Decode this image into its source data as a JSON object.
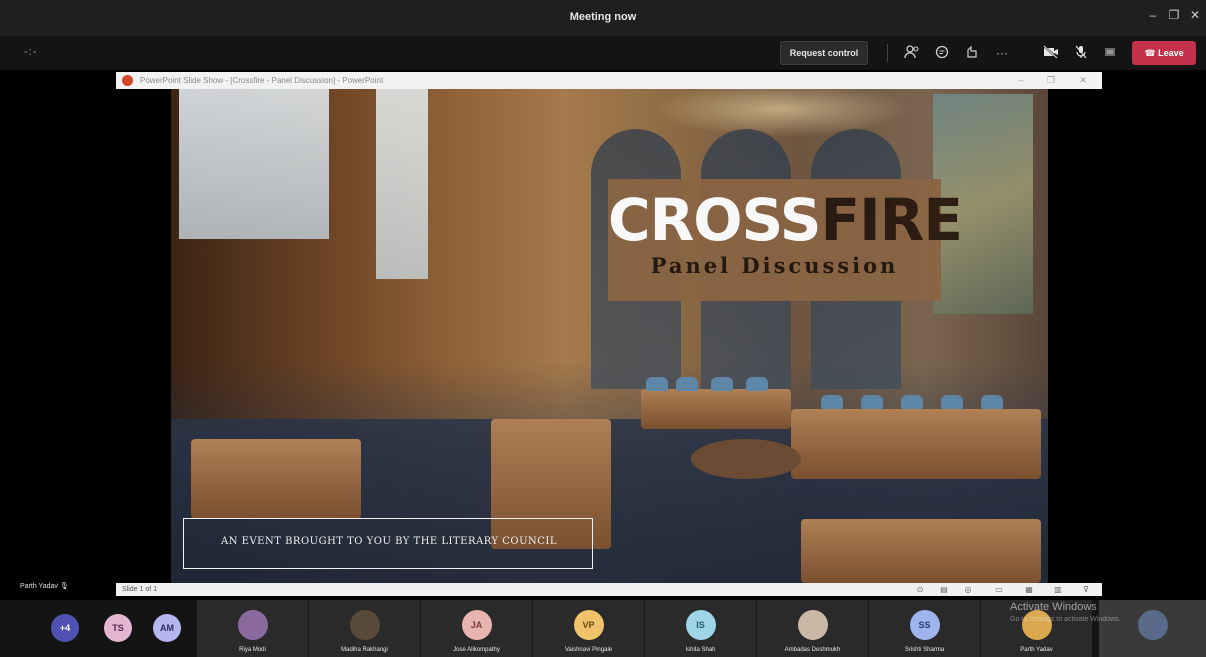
{
  "window": {
    "title": "Meeting now",
    "controls": {
      "minimize": "–",
      "restore": "❐",
      "close": "✕"
    }
  },
  "toolbar": {
    "timer": "-:-",
    "request_control": "Request control",
    "icons": [
      "participants-icon",
      "chat-icon",
      "reactions-icon",
      "more-icon",
      "camera-off-icon",
      "mic-off-icon",
      "share-icon"
    ],
    "leave": "Leave",
    "leave_color": "#c4314b"
  },
  "ppt": {
    "title": "PowerPoint Slide Show - [Crossfire - Panel Discussion] - PowerPoint",
    "status": "Slide 1 of 1"
  },
  "slide": {
    "title_part1": "CROSS",
    "title_part2": "FIRE",
    "subtitle": "Panel Discussion",
    "event_text": "AN EVENT BROUGHT TO YOU BY THE LITERARY COUNCIL"
  },
  "presenter": {
    "name": "Parth Yadav"
  },
  "participants": {
    "bubbles": [
      {
        "label": "+4",
        "color": "#4f52b2"
      },
      {
        "label": "TS",
        "color": "#e3b7d2"
      },
      {
        "label": "AM",
        "color": "#b4b6f0"
      }
    ],
    "tiles": [
      {
        "name": "Riya Modi",
        "initials": "",
        "color": "#8a6a9c"
      },
      {
        "name": "Madiha Rakhangi",
        "initials": "",
        "color": "#5a4a3a"
      },
      {
        "name": "Jose Alikompathy",
        "initials": "JA",
        "color": "#e8b4b0"
      },
      {
        "name": "Vaishnavi Pingale",
        "initials": "VP",
        "color": "#f0c36b"
      },
      {
        "name": "Ishita Shah",
        "initials": "IS",
        "color": "#9fd3e8"
      },
      {
        "name": "Ambadas Deshmukh",
        "initials": "",
        "color": "#c9b8a6"
      },
      {
        "name": "Srishti Sharma",
        "initials": "SS",
        "color": "#9fb4ea"
      },
      {
        "name": "Parth Yadav",
        "initials": "",
        "color": "#d9a84f"
      }
    ]
  },
  "watermark": {
    "title": "Activate Windows",
    "subtitle": "Go to Settings to activate Windows."
  }
}
